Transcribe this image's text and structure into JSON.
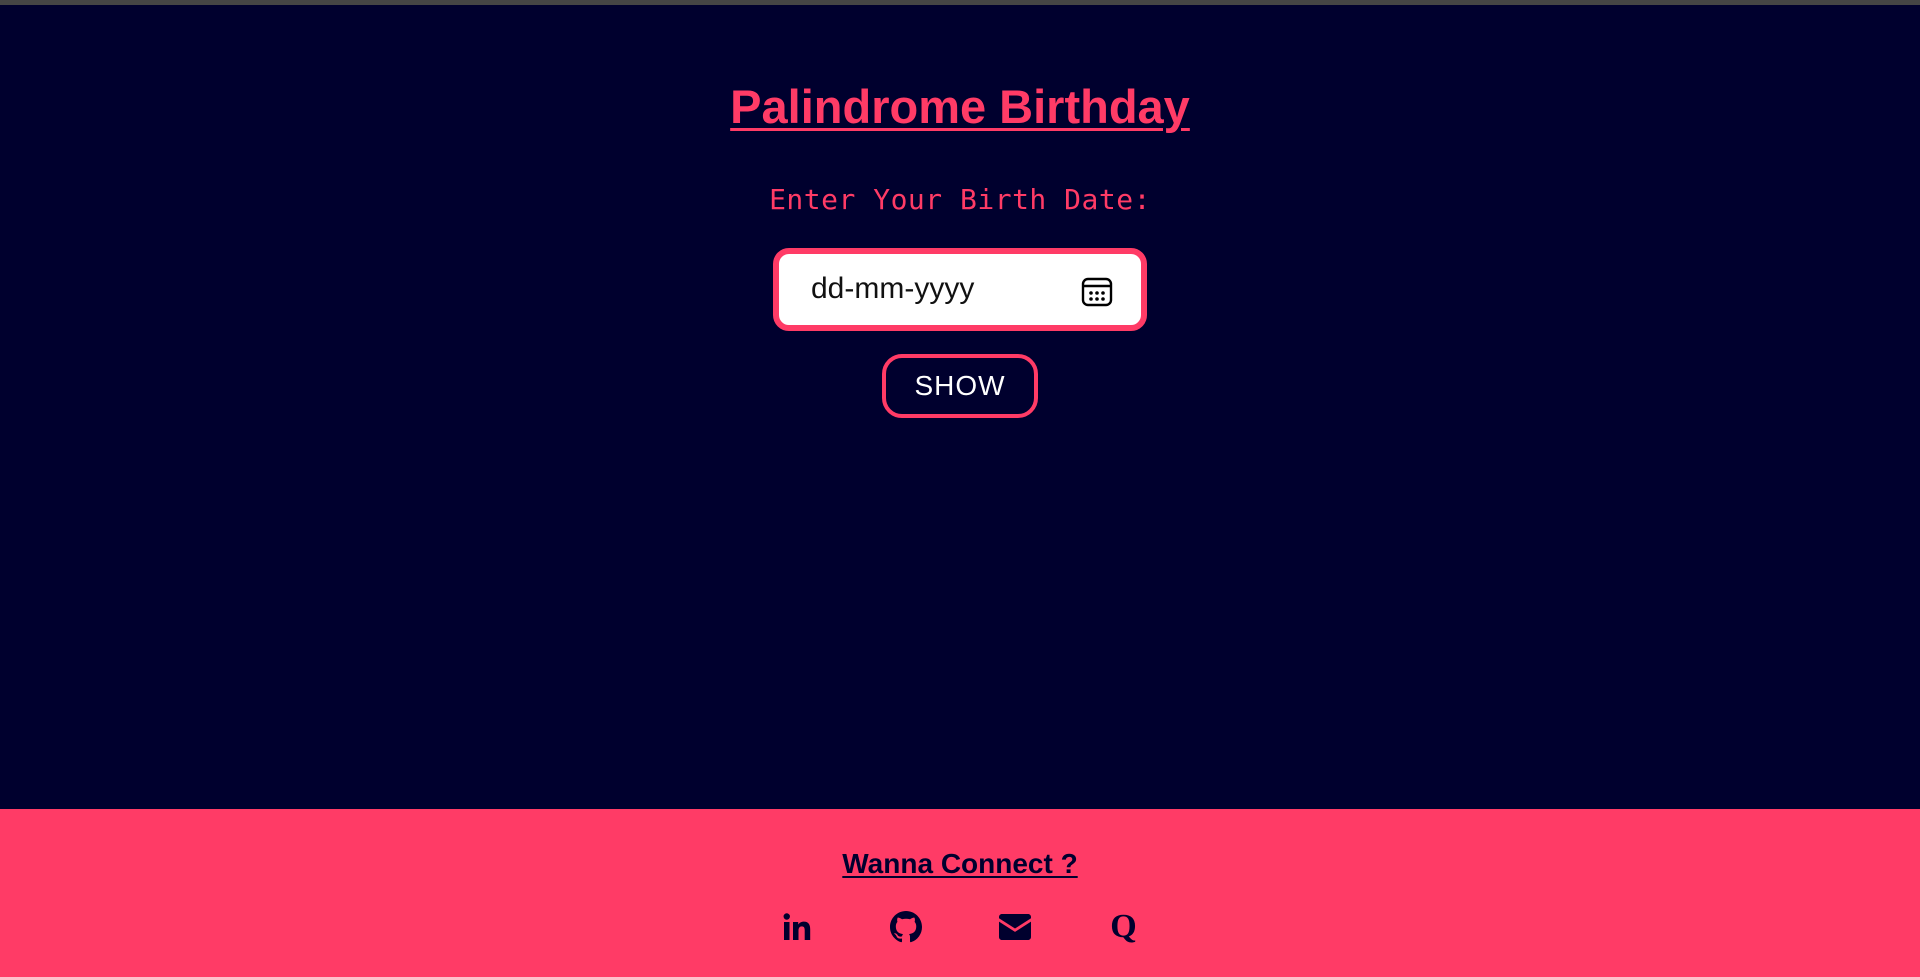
{
  "header": {
    "title": "Palindrome Birthday"
  },
  "form": {
    "label": "Enter Your Birth Date:",
    "date_placeholder": "dd-mm-yyyy",
    "calendar_icon": "calendar-icon",
    "button_label": "SHOW"
  },
  "footer": {
    "heading": "Wanna Connect ?",
    "links": [
      {
        "icon": "linkedin-icon"
      },
      {
        "icon": "github-icon"
      },
      {
        "icon": "mail-icon"
      },
      {
        "icon": "quora-icon",
        "glyph": "Q"
      }
    ]
  },
  "colors": {
    "background": "#00002e",
    "accent": "#ff3b66",
    "button_text": "#ffffff"
  }
}
